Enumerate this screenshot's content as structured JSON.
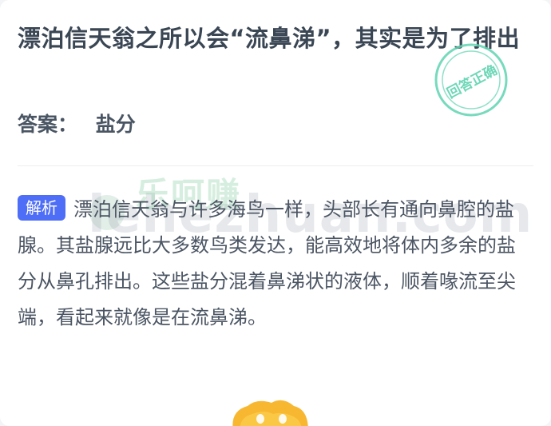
{
  "question": {
    "text": "漂泊信天翁之所以会“流鼻涕”，其实是为了排出"
  },
  "answer": {
    "label": "答案：",
    "value": "盐分"
  },
  "stamp": {
    "text": "回答正确",
    "color": "#5fd3b0"
  },
  "analysis": {
    "badge": "解析",
    "text": "漂泊信天翁与许多海鸟一样，头部长有通向鼻腔的盐腺。其盐腺远比大多数鸟类发达，能高效地将体内多余的盐分从鼻孔排出。这些盐分混着鼻涕状的液体，顺着喙流至尖端，看起来就像是在流鼻涕。"
  },
  "watermark": {
    "cn": "乐呵赚",
    "en": "lehezhuan.com"
  },
  "colors": {
    "badge": "#4f6ef7",
    "title": "#3a4654",
    "body": "#4b5563"
  }
}
